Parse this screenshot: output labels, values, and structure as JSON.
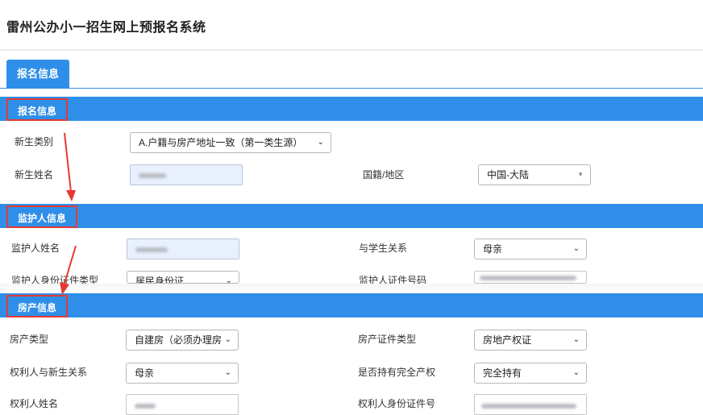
{
  "app": {
    "title": "雷州公办小一招生网上预报名系统"
  },
  "tabs": [
    {
      "label": "报名信息"
    }
  ],
  "sections": {
    "registration": {
      "title": "报名信息",
      "student_type_label": "新生类别",
      "student_type_value": "A.户籍与房产地址一致（第一类生源）",
      "student_name_label": "新生姓名",
      "nationality_label": "国籍/地区",
      "nationality_value": "中国-大陆"
    },
    "guardian": {
      "title": "监护人信息",
      "name_label": "监护人姓名",
      "relation_label": "与学生关系",
      "relation_value": "母亲",
      "id_type_label": "监护人身份证件类型",
      "id_type_value": "居民身份证",
      "id_number_label": "监护人证件号码"
    },
    "property": {
      "title": "房产信息",
      "type_label": "房产类型",
      "type_value": "自建房（必须办理房",
      "cert_type_label": "房产证件类型",
      "cert_type_value": "房地产权证",
      "owner_relation_label": "权利人与新生关系",
      "owner_relation_value": "母亲",
      "full_ownership_label": "是否持有完全产权",
      "full_ownership_value": "完全持有",
      "owner_name_label": "权利人姓名",
      "owner_id_label": "权利人身份证件号"
    }
  },
  "colors": {
    "accent": "#2f8fe8",
    "highlight": "#e53935"
  },
  "icons": {
    "caret": "chevron-down-icon",
    "arrow": "red-arrow-annotation"
  }
}
